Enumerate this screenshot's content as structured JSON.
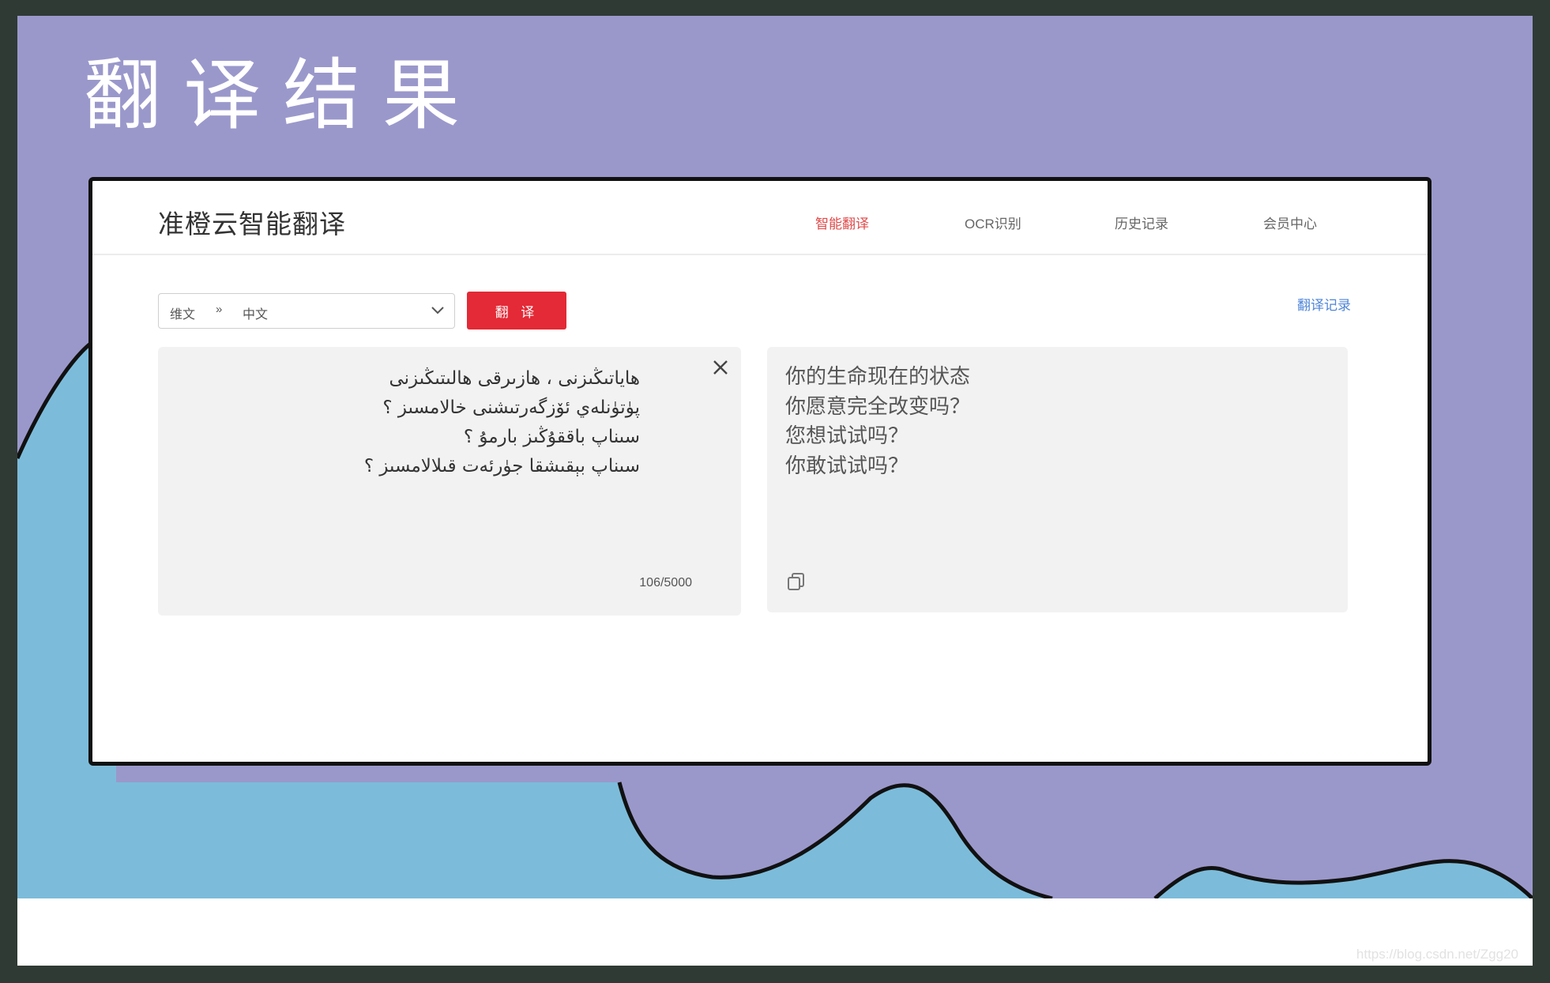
{
  "slide": {
    "title": "翻译结果",
    "watermark": "https://blog.csdn.net/Zgg20"
  },
  "app": {
    "brand": "准橙云智能翻译",
    "nav": [
      {
        "label": "智能翻译",
        "active": true
      },
      {
        "label": "OCR识别",
        "active": false
      },
      {
        "label": "历史记录",
        "active": false
      },
      {
        "label": "会员中心",
        "active": false
      }
    ]
  },
  "translator": {
    "source_lang": "维文",
    "arrow": "»",
    "target_lang": "中文",
    "translate_button": "翻 译",
    "history_link": "翻译记录",
    "source_text": "ھاياتىڭىزنى ، ھازىرقى ھالىتىڭىزنى\nپۈتۈنلەي ئۆزگەرتىشنى خالامسىز ؟\nسىناپ باققۇڭىز بارمۇ ؟\nسىناپ بېقىشقا جۈرئەت قىلالامسىز ؟",
    "char_count": "106/5000",
    "output_text": "你的生命现在的状态\n你愿意完全改变吗？\n您想试试吗？\n你敢试试吗？"
  },
  "colors": {
    "slide_bg": "#9a98cb",
    "hill_blue": "#7cbcda",
    "accent_red": "#e32a36",
    "nav_active": "#e04a4a",
    "link_blue": "#4f86d8"
  },
  "icons": [
    "close-icon",
    "chevron-down-icon",
    "copy-icon"
  ]
}
